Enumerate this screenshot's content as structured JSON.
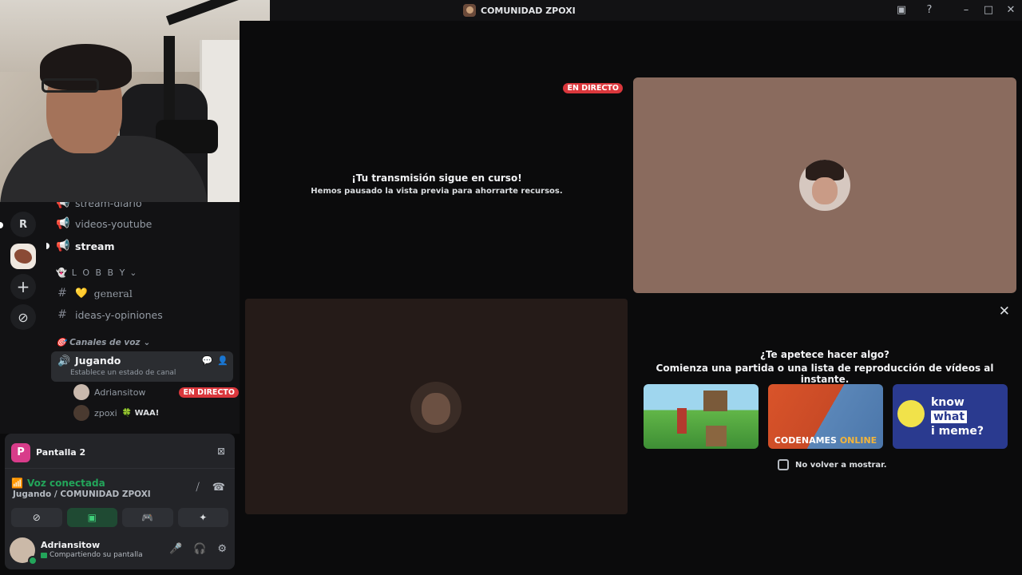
{
  "window": {
    "title": "COMUNIDAD ZPOXI",
    "controls": [
      "inbox-icon",
      "help-icon",
      "minimize-icon",
      "maximize-icon",
      "close-icon"
    ]
  },
  "rail": {
    "letter": "R"
  },
  "channels": {
    "top_partial": "stream-diario",
    "videos": "videos-youtube",
    "stream": "stream",
    "lobby_category": "L O B B Y",
    "general": "general",
    "ideas": "ideas-y-opiniones",
    "voice_category": "Canales de voz",
    "voice_channel": {
      "name": "Jugando",
      "subtitle": "Establece un estado de canal"
    },
    "members": [
      {
        "name": "Adriansitow",
        "badge": "EN DIRECTO"
      },
      {
        "name": "zpoxi",
        "status": "WAA!"
      }
    ]
  },
  "panel": {
    "screen_label": "Pantalla 2",
    "screen_icon_letter": "P",
    "voice_status": "Voz conectada",
    "voice_path": "Jugando / COMUNIDAD ZPOXI",
    "user": {
      "name": "Adriansitow",
      "status": "Compartiendo su pantalla"
    }
  },
  "stage": {
    "live_badge": "EN DIRECTO",
    "paused_title": "¡Tu transmisión sigue en curso!",
    "paused_subtitle": "Hemos pausado la vista previa para ahorrarte recursos.",
    "activity": {
      "question": "¿Te apetece hacer algo?",
      "prompt": "Comienza una partida o una lista de reproducción de vídeos al instante.",
      "cards": [
        {
          "name": "minecraft-style-card"
        },
        {
          "name": "codenames-card",
          "title_a": "CODENAMES",
          "title_b": "ONLINE"
        },
        {
          "name": "know-what-i-meme-card",
          "line1": "know",
          "line2": "what",
          "line3": "i meme?"
        }
      ],
      "dont_show": "No volver a mostrar."
    }
  },
  "colors": {
    "accent_green": "#23a55a",
    "live_red": "#da373c",
    "background": "#0b0b0c"
  }
}
